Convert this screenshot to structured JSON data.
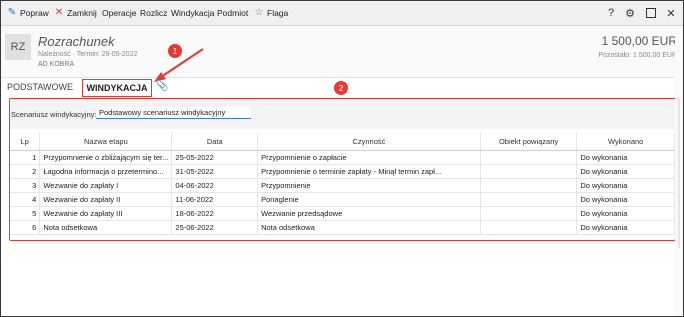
{
  "toolbar": {
    "items": [
      {
        "label": "Popraw",
        "icon": "pencil-icon"
      },
      {
        "label": "Zamknij",
        "icon": "close-x-icon"
      },
      {
        "label": "Operacje"
      },
      {
        "label": "Rozlicz"
      },
      {
        "label": "Windykacja"
      },
      {
        "label": "Podmiot"
      },
      {
        "label": "Flaga",
        "icon": "star-icon"
      }
    ],
    "help_glyph": "?",
    "colors": {
      "close_icon": "#e53935",
      "pencil_icon": "#1e6fd9"
    }
  },
  "header": {
    "avatar": "RZ",
    "title": "Rozrachunek",
    "meta": "Należność  ·  Termin: 28-05-2022",
    "contractor": "AD KOBRA",
    "amount": "1 500,00 EUR",
    "remaining": "Pozostało: 1 500,00 EUR"
  },
  "callouts": {
    "one": "1",
    "two": "2",
    "color": "#e53935"
  },
  "tabs": {
    "basic": "PODSTAWOWE",
    "collection": "WINDYKACJA"
  },
  "scenario": {
    "label": "Scenariusz windykacyjny:",
    "value": "Podstawowy scenariusz windykacyjny"
  },
  "table": {
    "columns": [
      "Lp",
      "Nazwa etapu",
      "Data",
      "Czynność",
      "Obiekt powiązany",
      "Wykonano"
    ],
    "rows": [
      {
        "lp": "1",
        "name": "Przypomnienie o zbliżającym się ter...",
        "date": "25-05-2022",
        "action": "Przypomnienie o zapłacie",
        "object": "",
        "done": "Do wykonania"
      },
      {
        "lp": "2",
        "name": "Łagodna informacja o przetermino...",
        "date": "31-05-2022",
        "action": "Przypomnienie o terminie zapłaty - Minął termin zapł...",
        "object": "",
        "done": "Do wykonania"
      },
      {
        "lp": "3",
        "name": "Wezwanie do zapłaty I",
        "date": "04-06-2022",
        "action": "Przypomnienie",
        "object": "",
        "done": "Do wykonania"
      },
      {
        "lp": "4",
        "name": "Wezwanie do zapłaty II",
        "date": "11-06-2022",
        "action": "Ponaglenie",
        "object": "",
        "done": "Do wykonania"
      },
      {
        "lp": "5",
        "name": "Wezwanie do zapłaty III",
        "date": "18-06-2022",
        "action": "Wezwanie przedsądowe",
        "object": "",
        "done": "Do wykonania"
      },
      {
        "lp": "6",
        "name": "Nota odsetkowa",
        "date": "25-06-2022",
        "action": "Nota odsetkowa",
        "object": "",
        "done": "Do wykonania"
      }
    ]
  }
}
